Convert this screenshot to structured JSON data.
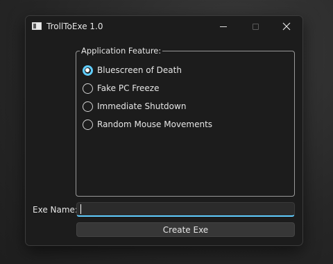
{
  "window": {
    "title": "TrollToExe 1.0"
  },
  "feature_group": {
    "title": "Application Feature:",
    "options": [
      {
        "label": "Bluescreen of Death",
        "checked": true
      },
      {
        "label": "Fake PC Freeze",
        "checked": false
      },
      {
        "label": "Immediate Shutdown",
        "checked": false
      },
      {
        "label": "Random Mouse Movements",
        "checked": false
      }
    ]
  },
  "exe_name": {
    "label": "Exe Name:",
    "value": "",
    "placeholder": ""
  },
  "create_button": {
    "label": "Create Exe"
  },
  "colors": {
    "accent": "#60cdff",
    "window_bg": "#1c1c1c",
    "text": "#e6e6e6"
  },
  "icons": {
    "app": "app-window-icon",
    "minimize": "minimize-icon",
    "maximize": "maximize-icon",
    "close": "close-icon"
  }
}
